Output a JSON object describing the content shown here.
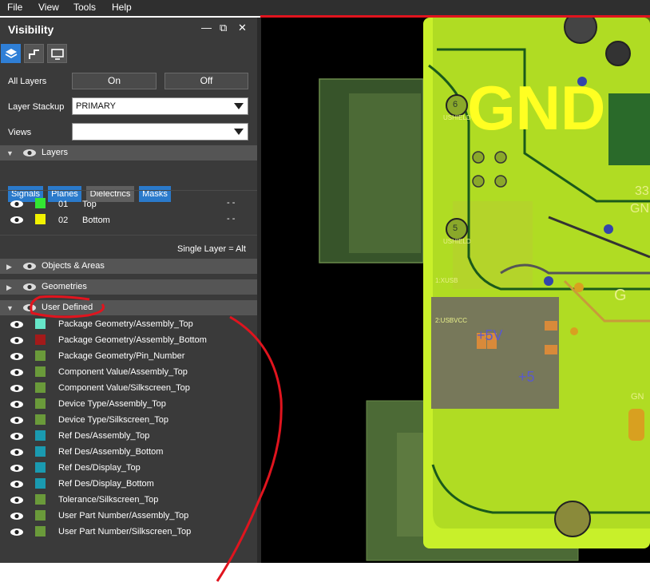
{
  "menu": {
    "file": "File",
    "view": "View",
    "tools": "Tools",
    "help": "Help"
  },
  "panel": {
    "title": "Visibility",
    "window_buttons": {
      "minimize": "—",
      "restore": "⧉",
      "close": "✕"
    },
    "tabs_icons": [
      "layers-icon",
      "routing-icon",
      "display-icon"
    ],
    "all_layers": {
      "label": "All Layers",
      "on": "On",
      "off": "Off"
    },
    "layer_stackup": {
      "label": "Layer Stackup",
      "value": "PRIMARY"
    },
    "views": {
      "label": "Views",
      "value": ""
    },
    "sections": {
      "layers": "Layers",
      "objects": "Objects & Areas",
      "geometries": "Geometries",
      "user_defined": "User Defined"
    },
    "filters": [
      "Signals",
      "Planes",
      "Dielectrics",
      "Masks"
    ],
    "layers_rows": [
      {
        "num": "01",
        "name": "Top",
        "dash": "- -",
        "color": "#33e633"
      },
      {
        "num": "02",
        "name": "Bottom",
        "dash": "- -",
        "color": "#f2f200"
      }
    ],
    "single_layer": "Single Layer = Alt",
    "user_rows": [
      {
        "name": "Package Geometry/Assembly_Top",
        "color": "#66e6c8"
      },
      {
        "name": "Package Geometry/Assembly_Bottom",
        "color": "#a31a1a"
      },
      {
        "name": "Package Geometry/Pin_Number",
        "color": "#6a9a3a"
      },
      {
        "name": "Component Value/Assembly_Top",
        "color": "#6a9a3a"
      },
      {
        "name": "Component Value/Silkscreen_Top",
        "color": "#6a9a3a"
      },
      {
        "name": "Device Type/Assembly_Top",
        "color": "#6a9a3a"
      },
      {
        "name": "Device Type/Silkscreen_Top",
        "color": "#6a9a3a"
      },
      {
        "name": "Ref Des/Assembly_Top",
        "color": "#1a9ab0"
      },
      {
        "name": "Ref Des/Assembly_Bottom",
        "color": "#1a9ab0"
      },
      {
        "name": "Ref Des/Display_Top",
        "color": "#1a9ab0"
      },
      {
        "name": "Ref Des/Display_Bottom",
        "color": "#1a9ab0"
      },
      {
        "name": "Tolerance/Silkscreen_Top",
        "color": "#6a9a3a"
      },
      {
        "name": "User Part Number/Assembly_Top",
        "color": "#6a9a3a"
      },
      {
        "name": "User Part Number/Silkscreen_Top",
        "color": "#6a9a3a"
      }
    ]
  },
  "board": {
    "gnd_big": "GND",
    "labels": [
      "6",
      "5",
      "USHIELD",
      "USHIELD",
      "1:XUSB",
      "2:USBVCC",
      "+5V",
      "+5",
      "33",
      "GN",
      "G",
      "GN"
    ]
  },
  "colors": {
    "accent": "#2a7acb",
    "annotation": "#e0141e",
    "board": "#c6ff1a"
  }
}
